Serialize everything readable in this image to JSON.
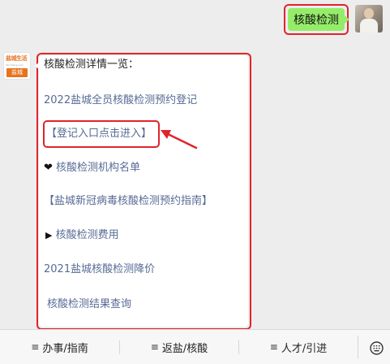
{
  "outgoing": {
    "text": "核酸检测"
  },
  "incoming": {
    "avatar": {
      "logo_text": "盐城生活",
      "logo_sub": "Yancheng.com",
      "tag_text": "盐城"
    },
    "intro": "核酸检测详情一览：",
    "items": [
      {
        "prefix": "",
        "text": "2022盐城全员核酸检测预约登记"
      },
      {
        "prefix": "",
        "text": "【登记入口点击进入】"
      },
      {
        "prefix": "❤",
        "text": " 核酸检测机构名单"
      },
      {
        "prefix": "",
        "text": "【盐城新冠病毒核酸检测预约指南】"
      },
      {
        "prefix": "▶",
        "text": " 核酸检测费用"
      },
      {
        "prefix": "",
        "text": "2021盐城核酸检测降价"
      },
      {
        "prefix": "",
        "text": "核酸检测结果查询"
      }
    ]
  },
  "menu": {
    "items": [
      {
        "icon": "menu-lines-icon",
        "label": "办事/指南"
      },
      {
        "icon": "menu-lines-icon",
        "label": "返盐/核酸"
      },
      {
        "icon": "menu-lines-icon",
        "label": "人才/引进"
      }
    ],
    "keyboard_icon": "keyboard-icon"
  },
  "colors": {
    "highlight": "#e0242c",
    "link": "#576b95",
    "bubble_out": "#95ec69",
    "background": "#ededed"
  }
}
